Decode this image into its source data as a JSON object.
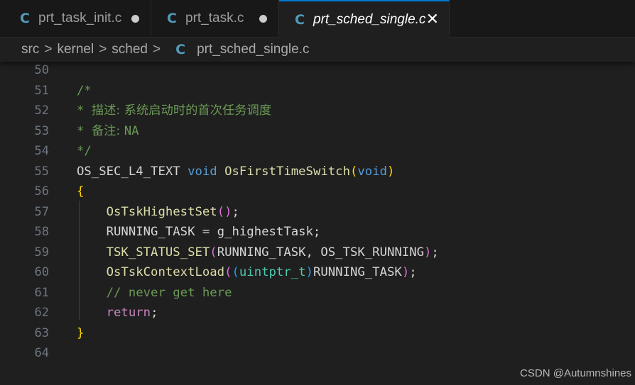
{
  "tabs": [
    {
      "icon_text": "C",
      "icon": "c-file-icon",
      "label": "prt_task_init.c",
      "state": "modified"
    },
    {
      "icon_text": "C",
      "icon": "c-file-icon",
      "label": "prt_task.c",
      "state": "modified"
    },
    {
      "icon_text": "C",
      "icon": "c-file-icon",
      "label": "prt_sched_single.c",
      "state": "active",
      "close_glyph": "✕"
    }
  ],
  "breadcrumb": {
    "items": [
      "src",
      "kernel",
      "sched"
    ],
    "separator": ">",
    "file_icon_text": "C",
    "file": "prt_sched_single.c"
  },
  "editor": {
    "lines": [
      {
        "num": "50",
        "tokens": []
      },
      {
        "num": "51",
        "tokens": [
          {
            "t": "/*",
            "c": "#6a9955"
          }
        ]
      },
      {
        "num": "52",
        "tokens": [
          {
            "t": "* ",
            "c": "#6a9955"
          },
          {
            "t": "描述: 系统启动时的首次任务调度",
            "c": "#6a9955",
            "cn": true
          }
        ]
      },
      {
        "num": "53",
        "tokens": [
          {
            "t": "* ",
            "c": "#6a9955"
          },
          {
            "t": "备注: ",
            "c": "#6a9955",
            "cn": true
          },
          {
            "t": "NA",
            "c": "#6a9955"
          }
        ]
      },
      {
        "num": "54",
        "tokens": [
          {
            "t": "*/",
            "c": "#6a9955"
          }
        ]
      },
      {
        "num": "55",
        "tokens": [
          {
            "t": "OS_SEC_L4_TEXT ",
            "c": "#d4d4d4"
          },
          {
            "t": "void ",
            "c": "#569cd6"
          },
          {
            "t": "OsFirstTimeSwitch",
            "c": "#dcdcaa"
          },
          {
            "t": "(",
            "c": "#ffd700"
          },
          {
            "t": "void",
            "c": "#569cd6"
          },
          {
            "t": ")",
            "c": "#ffd700"
          }
        ]
      },
      {
        "num": "56",
        "tokens": [
          {
            "t": "{",
            "c": "#ffd700"
          }
        ]
      },
      {
        "num": "57",
        "tokens": [
          {
            "t": "    OsTskHighestSet",
            "c": "#dcdcaa"
          },
          {
            "t": "()",
            "c": "#da70d6"
          },
          {
            "t": ";",
            "c": "#d4d4d4"
          }
        ]
      },
      {
        "num": "58",
        "tokens": [
          {
            "t": "    RUNNING_TASK = g_highestTask;",
            "c": "#d4d4d4"
          }
        ]
      },
      {
        "num": "59",
        "tokens": [
          {
            "t": "    TSK_STATUS_SET",
            "c": "#dcdcaa"
          },
          {
            "t": "(",
            "c": "#da70d6"
          },
          {
            "t": "RUNNING_TASK, OS_TSK_RUNNING",
            "c": "#d4d4d4"
          },
          {
            "t": ")",
            "c": "#da70d6"
          },
          {
            "t": ";",
            "c": "#d4d4d4"
          }
        ]
      },
      {
        "num": "60",
        "tokens": [
          {
            "t": "    OsTskContextLoad",
            "c": "#dcdcaa"
          },
          {
            "t": "(",
            "c": "#da70d6"
          },
          {
            "t": "(",
            "c": "#179fff"
          },
          {
            "t": "uintptr_t",
            "c": "#4ec9b0"
          },
          {
            "t": ")",
            "c": "#179fff"
          },
          {
            "t": "RUNNING_TASK",
            "c": "#d4d4d4"
          },
          {
            "t": ")",
            "c": "#da70d6"
          },
          {
            "t": ";",
            "c": "#d4d4d4"
          }
        ]
      },
      {
        "num": "61",
        "tokens": [
          {
            "t": "    // never get here",
            "c": "#6a9955"
          }
        ]
      },
      {
        "num": "62",
        "tokens": [
          {
            "t": "    ",
            "c": "#d4d4d4"
          },
          {
            "t": "return",
            "c": "#c586c0"
          },
          {
            "t": ";",
            "c": "#d4d4d4"
          }
        ]
      },
      {
        "num": "63",
        "tokens": [
          {
            "t": "}",
            "c": "#ffd700"
          }
        ]
      },
      {
        "num": "64",
        "tokens": []
      }
    ]
  },
  "watermark": "CSDN @Autumnshines",
  "colors": {
    "accent": "#0078d4",
    "c_icon": "#519aba",
    "background": "#1f1f1f",
    "tabbar": "#181818"
  }
}
